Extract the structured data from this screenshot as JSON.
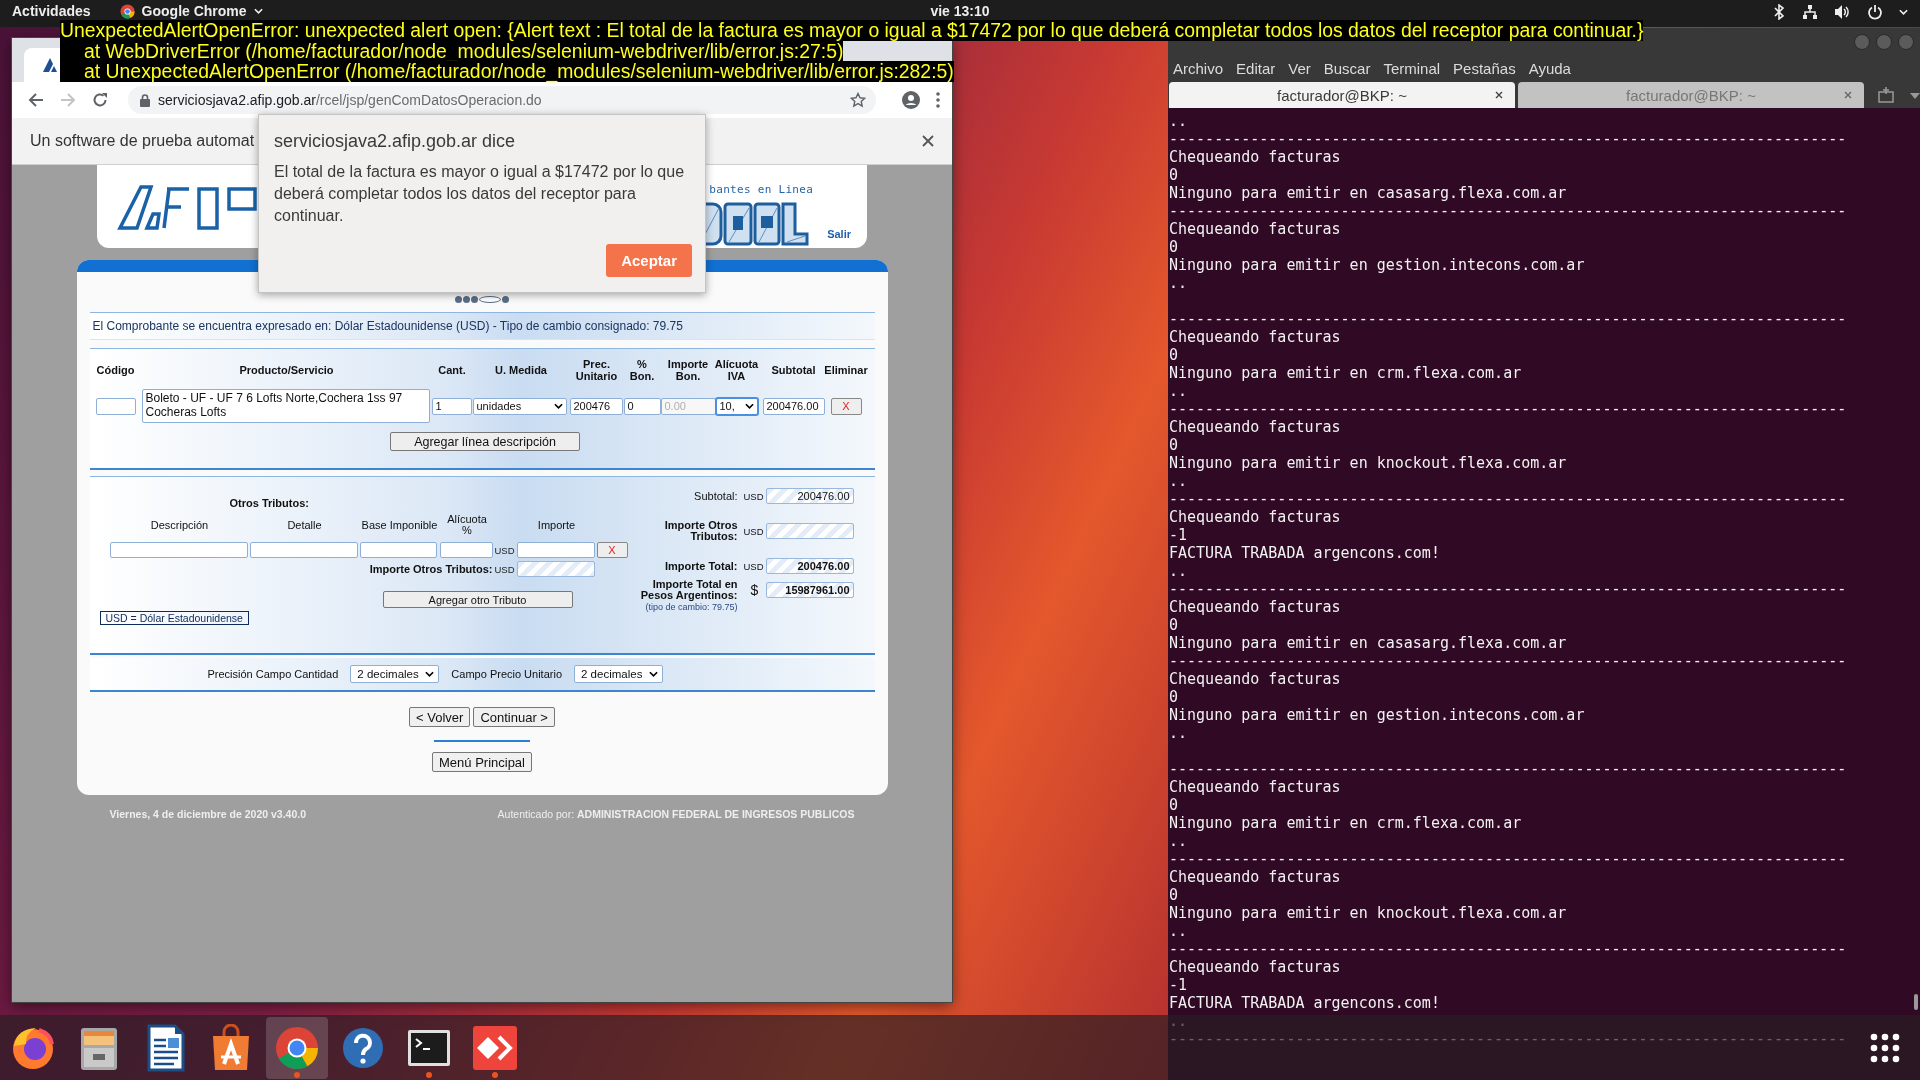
{
  "top_bar": {
    "activities": "Actividades",
    "app_menu": "Google Chrome",
    "clock": "vie 13:10"
  },
  "error_overlay": [
    {
      "text": "UnexpectedAlertOpenError: unexpected alert open: {Alert text : El total de la factura es mayor o igual a $17472 por lo que deberá completar todos los datos del receptor para continuar.}",
      "indent": false
    },
    {
      "text": "at WebDriverError (/home/facturador/node_modules/selenium-webdriver/lib/error.js:27:5)",
      "indent": true
    },
    {
      "text": "at UnexpectedAlertOpenError (/home/facturador/node_modules/selenium-webdriver/lib/error.js:282:5)",
      "indent": true
    }
  ],
  "browser": {
    "url_host": "serviciosjava2.afip.gob.ar",
    "url_path": "/rcel/jsp/genComDatosOperacion.do",
    "forward_disabled": true,
    "infobar": "Un software de prueba automat",
    "page": {
      "header": {
        "tagline": "bantes en Linea",
        "logout": "Salir"
      },
      "steps": [
        {
          "selected": false
        },
        {
          "selected": false
        },
        {
          "selected": false
        },
        {
          "selected": true
        },
        {
          "selected": false
        }
      ],
      "currency_note": "El Comprobante se encuentra expresado en: Dólar Estadounidense (USD) - Tipo de cambio consignado: 79.75",
      "items": {
        "columns": [
          "Código",
          "Producto/Servicio",
          "Cant.",
          "U. Medida",
          "Prec. Unitario",
          "% Bon.",
          "Importe Bon.",
          "Alícuota IVA",
          "Subtotal",
          "Eliminar"
        ],
        "rows": [
          {
            "product": "Boleto - UF - UF 7 6 Lofts Norte,Cochera 1ss 97 Cocheras Lofts",
            "quantity": "1",
            "unit": "unidades",
            "unit_price": "200476",
            "discount_pct": "0",
            "discount_amount": "0.00",
            "discount_amount_disabled": true,
            "vat_rate": "10,",
            "vat_focused": true,
            "subtotal": "200476.00",
            "delete": "X"
          }
        ],
        "add_button": "Agregar línea descripción"
      },
      "tributes": {
        "title": "Otros Tributos:",
        "columns": [
          "Descripción",
          "Detalle",
          "Base Imponible",
          "Alícuota %",
          "Importe"
        ],
        "currency": "USD",
        "delete": "X",
        "total_label": "Importe Otros Tributos:",
        "total_currency": "USD",
        "add_button": "Agregar otro Tributo",
        "legend": "USD = Dólar Estadounidense"
      },
      "totals": [
        {
          "label": "Subtotal:",
          "currency": "USD",
          "value": "200476.00",
          "bold": false
        },
        {
          "label": "Importe Otros Tributos:",
          "currency": "USD",
          "bold": true
        },
        {
          "label": "Importe Total:",
          "currency": "USD",
          "value": "200476.00",
          "bold": true
        },
        {
          "label": "Importe Total en Pesos Argentinos:",
          "currency": "$",
          "value": "15987961.00",
          "bold": true,
          "note": "(tipo de cambio: 79.75)"
        }
      ],
      "precision": [
        {
          "label": "Precisión Campo Cantidad",
          "value": "2 decimales"
        },
        {
          "label": "Campo Precio Unitario",
          "value": "2 decimales"
        }
      ],
      "nav_buttons": [
        "< Volver",
        "Continuar >"
      ],
      "main_menu": "Menú Principal",
      "footer": {
        "date": "Viernes, 4 de diciembre de 2020 v3.40.0",
        "auth_label": "Autenticado por:",
        "auth_org": "ADMINISTRACION FEDERAL DE INGRESOS PUBLICOS"
      }
    }
  },
  "alert": {
    "title": "serviciosjava2.afip.gob.ar dice",
    "message": "El total de la factura es mayor o igual a $17472 por lo que deberá completar todos los datos del receptor para continuar.",
    "button": "Aceptar"
  },
  "terminal": {
    "menu": [
      "Archivo",
      "Editar",
      "Ver",
      "Buscar",
      "Terminal",
      "Pestañas",
      "Ayuda"
    ],
    "tabs": [
      {
        "label": "facturador@BKP: ~",
        "selected": true
      },
      {
        "label": "facturador@BKP: ~",
        "selected": false
      }
    ],
    "lines": [
      {
        "kind": "output",
        "text": ".."
      },
      {
        "kind": "output",
        "text": "---------------------------------------------------------------------------"
      },
      {
        "kind": "output",
        "text": "Chequeando facturas"
      },
      {
        "kind": "output",
        "text": "0"
      },
      {
        "kind": "output",
        "text": "Ninguno para emitir en casasarg.flexa.com.ar"
      },
      {
        "kind": "output",
        "text": "---------------------------------------------------------------------------"
      },
      {
        "kind": "output",
        "text": "Chequeando facturas"
      },
      {
        "kind": "output",
        "text": "0"
      },
      {
        "kind": "output",
        "text": "Ninguno para emitir en gestion.intecons.com.ar"
      },
      {
        "kind": "output",
        "text": ".."
      },
      {
        "kind": "blank"
      },
      {
        "kind": "output",
        "text": "---------------------------------------------------------------------------"
      },
      {
        "kind": "output",
        "text": "Chequeando facturas"
      },
      {
        "kind": "output",
        "text": "0"
      },
      {
        "kind": "output",
        "text": "Ninguno para emitir en crm.flexa.com.ar"
      },
      {
        "kind": "output",
        "text": ".."
      },
      {
        "kind": "output",
        "text": "---------------------------------------------------------------------------"
      },
      {
        "kind": "output",
        "text": "Chequeando facturas"
      },
      {
        "kind": "output",
        "text": "0"
      },
      {
        "kind": "output",
        "text": "Ninguno para emitir en knockout.flexa.com.ar"
      },
      {
        "kind": "output",
        "text": ".."
      },
      {
        "kind": "output",
        "text": "---------------------------------------------------------------------------"
      },
      {
        "kind": "output",
        "text": "Chequeando facturas"
      },
      {
        "kind": "output",
        "text": "-1"
      },
      {
        "kind": "output",
        "text": "FACTURA TRABADA argencons.com!"
      },
      {
        "kind": "output",
        "text": ".."
      },
      {
        "kind": "output",
        "text": "---------------------------------------------------------------------------"
      },
      {
        "kind": "output",
        "text": "Chequeando facturas"
      },
      {
        "kind": "output",
        "text": "0"
      },
      {
        "kind": "output",
        "text": "Ninguno para emitir en casasarg.flexa.com.ar"
      },
      {
        "kind": "output",
        "text": "---------------------------------------------------------------------------"
      },
      {
        "kind": "output",
        "text": "Chequeando facturas"
      },
      {
        "kind": "output",
        "text": "0"
      },
      {
        "kind": "output",
        "text": "Ninguno para emitir en gestion.intecons.com.ar"
      },
      {
        "kind": "output",
        "text": ".."
      },
      {
        "kind": "blank"
      },
      {
        "kind": "output",
        "text": "---------------------------------------------------------------------------"
      },
      {
        "kind": "output",
        "text": "Chequeando facturas"
      },
      {
        "kind": "output",
        "text": "0"
      },
      {
        "kind": "output",
        "text": "Ninguno para emitir en crm.flexa.com.ar"
      },
      {
        "kind": "output",
        "text": ".."
      },
      {
        "kind": "output",
        "text": "---------------------------------------------------------------------------"
      },
      {
        "kind": "output",
        "text": "Chequeando facturas"
      },
      {
        "kind": "output",
        "text": "0"
      },
      {
        "kind": "output",
        "text": "Ninguno para emitir en knockout.flexa.com.ar"
      },
      {
        "kind": "output",
        "text": ".."
      },
      {
        "kind": "output",
        "text": "---------------------------------------------------------------------------"
      },
      {
        "kind": "output",
        "text": "Chequeando facturas"
      },
      {
        "kind": "output",
        "text": "-1"
      },
      {
        "kind": "output",
        "text": "FACTURA TRABADA argencons.com!"
      },
      {
        "kind": "output",
        "text": ".."
      },
      {
        "kind": "output",
        "text": "---------------------------------------------------------------------------"
      }
    ]
  },
  "dock": {
    "items": [
      {
        "kind": "firefox",
        "selected": false,
        "running": false
      },
      {
        "kind": "files",
        "selected": false,
        "running": false
      },
      {
        "kind": "writer",
        "selected": false,
        "running": false
      },
      {
        "kind": "store",
        "selected": false,
        "running": false
      },
      {
        "kind": "chrome",
        "selected": true,
        "running": true
      },
      {
        "kind": "help",
        "selected": false,
        "running": false
      },
      {
        "kind": "terminal",
        "selected": false,
        "running": true
      },
      {
        "kind": "remote",
        "selected": false,
        "running": true
      }
    ]
  }
}
